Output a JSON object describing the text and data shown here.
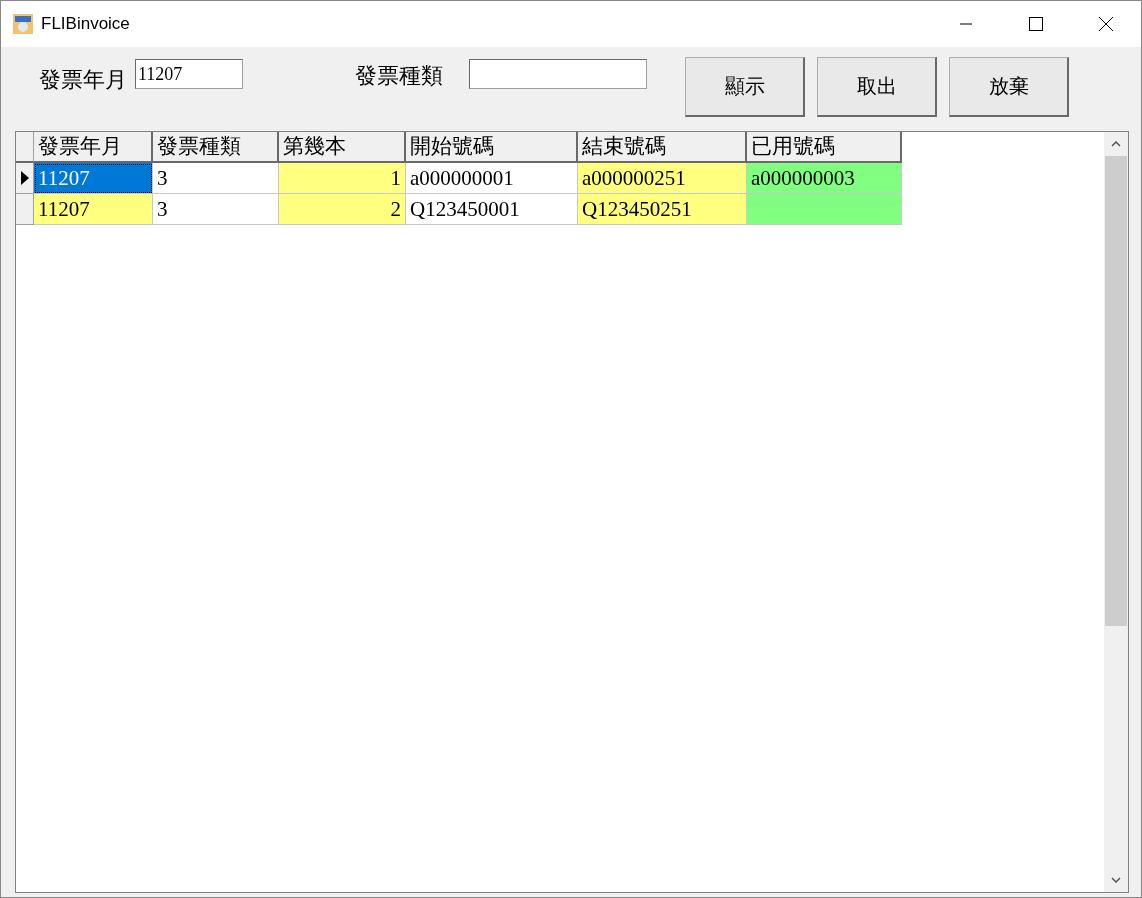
{
  "window": {
    "title": "FLIBinvoice"
  },
  "filters": [
    {
      "label": "發票年月",
      "value": "11207"
    },
    {
      "label": "發票種類"
    }
  ],
  "buttons": [
    "顯示",
    "取出",
    "放棄"
  ],
  "table": {
    "columns": [
      {
        "label": "發票年月",
        "kind": "text"
      },
      {
        "label": "發票種類",
        "kind": "text"
      },
      {
        "label": "第幾本",
        "kind": "number"
      },
      {
        "label": "開始號碼",
        "kind": "text"
      },
      {
        "label": "結束號碼",
        "kind": "text"
      },
      {
        "label": "已用號碼",
        "kind": "text"
      }
    ],
    "rows": [
      {
        "selected": true,
        "cells": [
          {
            "text": "11207",
            "color": "#0078d7",
            "selected": true
          },
          {
            "text": "3",
            "color": "#ffffff",
            "selected": false
          },
          {
            "text": "1",
            "color": "#ffff80",
            "selected": false
          },
          {
            "text": "a000000001",
            "color": "#ffffff",
            "selected": false
          },
          {
            "text": "a000000251",
            "color": "#ffff80",
            "selected": false
          },
          {
            "text": "a000000003",
            "color": "#80ff80",
            "selected": false
          }
        ]
      },
      {
        "selected": false,
        "cells": [
          {
            "text": "11207",
            "color": "#ffff80",
            "selected": false
          },
          {
            "text": "3",
            "color": "#ffffff",
            "selected": false
          },
          {
            "text": "2",
            "color": "#ffff80",
            "selected": false
          },
          {
            "text": "Q123450001",
            "color": "#ffffff",
            "selected": false
          },
          {
            "text": "Q123450251",
            "color": "#ffff80",
            "selected": false
          },
          {
            "color": "#80ff80",
            "selected": false
          }
        ]
      }
    ]
  }
}
